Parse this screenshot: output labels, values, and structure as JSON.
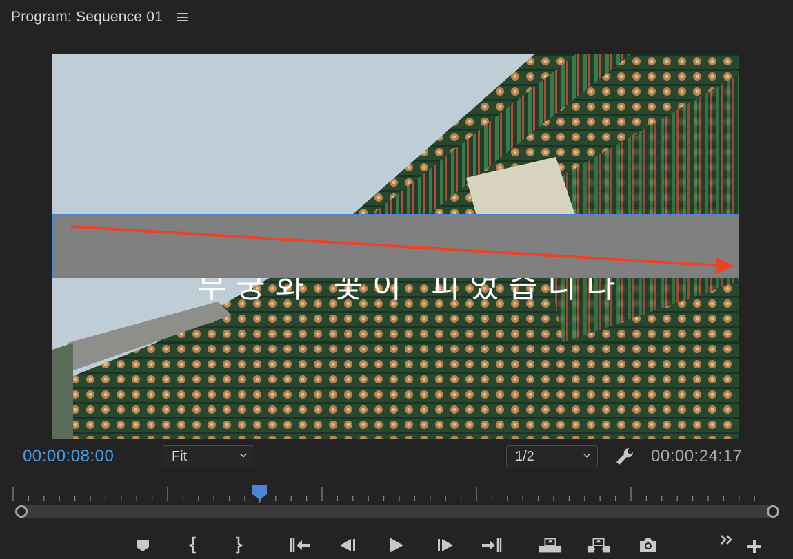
{
  "panel": {
    "title": "Program: Sequence 01",
    "menu_icon": "hamburger-menu-icon"
  },
  "viewer": {
    "overlay_text": "무궁화 꽃이 피었습니다",
    "accent": "#4a86d8",
    "arrow_color": "#e8442a"
  },
  "controls": {
    "current_timecode": "00:00:08:00",
    "zoom_select": "Fit",
    "resolution_select": "1/2",
    "duration_timecode": "00:00:24:17",
    "timecode_color": "#4a9be8",
    "settings_icon": "wrench-icon"
  },
  "transport": {
    "buttons": [
      "add-marker-icon",
      "mark-in-icon",
      "mark-out-icon",
      "go-to-in-icon",
      "step-back-icon",
      "play-icon",
      "step-forward-icon",
      "go-to-out-icon",
      "lift-icon",
      "extract-icon",
      "export-frame-icon",
      "more-controls-icon",
      "button-editor-icon"
    ]
  }
}
